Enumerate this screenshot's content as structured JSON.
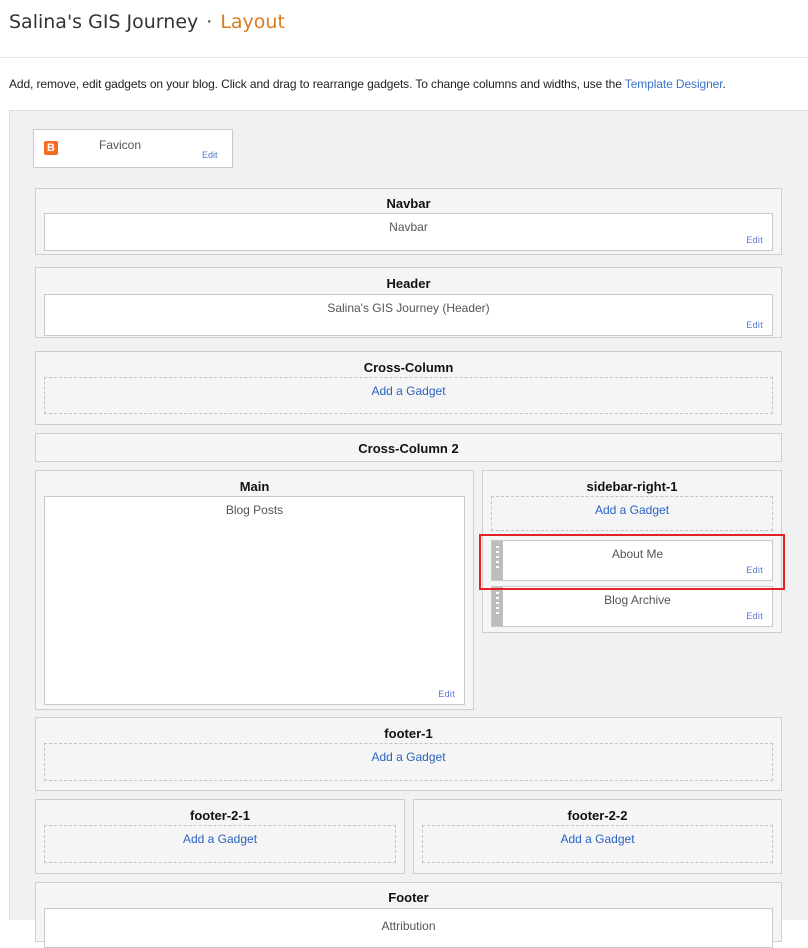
{
  "header": {
    "blog_title": "Salina's GIS Journey",
    "separator": "·",
    "section": "Layout"
  },
  "intro": {
    "text": "Add, remove, edit gadgets on your blog. Click and drag to rearrange gadgets. To change columns and widths, use the ",
    "link": "Template Designer",
    "period": "."
  },
  "common": {
    "edit": "Edit",
    "add_gadget": "Add a Gadget"
  },
  "favicon": {
    "label": "Favicon",
    "icon": "blogger-logo-icon",
    "brand_color": "#f26d21"
  },
  "sections": {
    "navbar": {
      "title": "Navbar",
      "gadget": "Navbar"
    },
    "header": {
      "title": "Header",
      "gadget": "Salina's GIS Journey (Header)"
    },
    "cross_column": {
      "title": "Cross-Column"
    },
    "cross_column_2": {
      "title": "Cross-Column 2"
    },
    "main": {
      "title": "Main",
      "gadget": "Blog Posts"
    },
    "sidebar_right_1": {
      "title": "sidebar-right-1",
      "gadgets": [
        "About Me",
        "Blog Archive"
      ]
    },
    "footer_1": {
      "title": "footer-1"
    },
    "footer_2_1": {
      "title": "footer-2-1"
    },
    "footer_2_2": {
      "title": "footer-2-2"
    },
    "footer": {
      "title": "Footer",
      "gadget": "Attribution"
    }
  },
  "colors": {
    "accent": "#dd7b1f",
    "link": "#3a74c9",
    "highlight": "#e52222"
  }
}
